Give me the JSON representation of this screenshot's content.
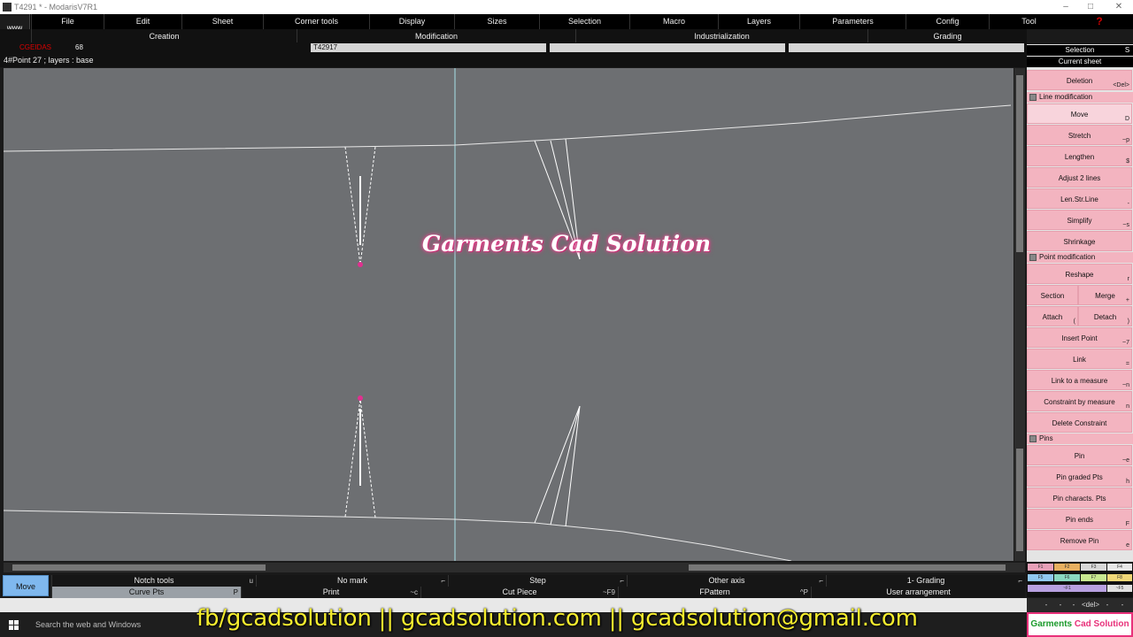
{
  "window": {
    "title": "T4291 * - ModarisV7R1"
  },
  "menubar": {
    "www": "www",
    "items": [
      "File",
      "Edit",
      "Sheet",
      "Corner tools",
      "Display",
      "Sizes",
      "Selection",
      "Macro",
      "Layers",
      "Parameters",
      "Config",
      "Tool"
    ],
    "help": "?"
  },
  "modes": [
    "Creation",
    "Modification",
    "Industrialization",
    "Grading"
  ],
  "editbar": {
    "red_label": "CGEIDAS",
    "size_value": "68",
    "piece_name": "T42917"
  },
  "info": {
    "text": "4#Point 27 ;    layers :  base"
  },
  "watermark": "Garments Cad Solution",
  "right_panel": {
    "header": "Selection",
    "header_key": "S",
    "subheader": "Current sheet",
    "deletion": {
      "label": "Deletion",
      "key": "<Del>"
    },
    "line_section": "Line modification",
    "line_items": [
      {
        "label": "Move",
        "key": "D"
      },
      {
        "label": "Stretch",
        "key": "~p"
      },
      {
        "label": "Lengthen",
        "key": "$"
      },
      {
        "label": "Adjust 2 lines",
        "key": ""
      },
      {
        "label": "Len.Str.Line",
        "key": "-"
      },
      {
        "label": "Simplify",
        "key": "~s"
      },
      {
        "label": "Shrinkage",
        "key": ""
      }
    ],
    "point_section": "Point modification",
    "reshape": {
      "label": "Reshape",
      "key": "r"
    },
    "section": {
      "label": "Section",
      "key": ""
    },
    "merge": {
      "label": "Merge",
      "key": "+"
    },
    "attach": {
      "label": "Attach",
      "key": "("
    },
    "detach": {
      "label": "Detach",
      "key": ")"
    },
    "point_items": [
      {
        "label": "Insert Point",
        "key": "~7"
      },
      {
        "label": "Link",
        "key": "="
      },
      {
        "label": "Link to a measure",
        "key": "~n"
      },
      {
        "label": "Constraint by measure",
        "key": "n"
      },
      {
        "label": "Delete Constraint",
        "key": ""
      }
    ],
    "pins_section": "Pins",
    "pin_items": [
      {
        "label": "Pin",
        "key": "~e"
      },
      {
        "label": "Pin graded Pts",
        "key": "h"
      },
      {
        "label": "Pin characts. Pts",
        "key": ""
      },
      {
        "label": "Pin ends",
        "key": "F"
      },
      {
        "label": "Remove Pin",
        "key": "e"
      }
    ],
    "grading_keys": [
      "F1",
      "F2",
      "F3",
      "F4",
      "F5",
      "F6",
      "F7",
      "F8",
      "~F1",
      "~F5"
    ],
    "bottom_keys": [
      "-",
      "-",
      "-",
      "<del>",
      "-",
      "-"
    ]
  },
  "bottom_toolbar": {
    "move": "Move",
    "row1": [
      {
        "label": "Notch tools",
        "key": "u"
      },
      {
        "label": "No mark",
        "key": "⌐"
      },
      {
        "label": "Step",
        "key": "⌐"
      },
      {
        "label": "Other axis",
        "key": "⌐"
      },
      {
        "label": "1- Grading",
        "key": "⌐"
      }
    ],
    "row2": [
      {
        "label": "Curve Pts",
        "key": "P"
      },
      {
        "label": "Print",
        "key": "~c"
      },
      {
        "label": "Cut Piece",
        "key": "~F9"
      },
      {
        "label": "FPattern",
        "key": "^P"
      },
      {
        "label": "User arrangement",
        "key": ""
      }
    ]
  },
  "taskbar": {
    "search": "Search the web and Windows"
  },
  "social": "fb/gcadsolution || gcadsolution.com || gcadsolution@gmail.com",
  "brand": {
    "green": "Garments",
    "red": "Cad Solution"
  },
  "colors": {
    "button_pink": "#f3b4c0",
    "move_blue": "#7fb8ee",
    "canvas": "#6d6f72",
    "watermark_glow": "#e0307f",
    "social_text": "#f4ec2e"
  }
}
